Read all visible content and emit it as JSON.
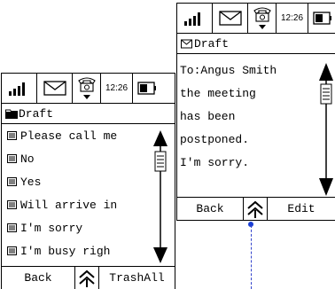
{
  "left_screen": {
    "status": {
      "time": "12:26"
    },
    "title": "Draft",
    "items": [
      {
        "label": "Please call me"
      },
      {
        "label": "No"
      },
      {
        "label": "Yes"
      },
      {
        "label": "Will arrive in"
      },
      {
        "label": "I'm sorry"
      },
      {
        "label": "I'm busy righ"
      }
    ],
    "buttons": {
      "left": "Back",
      "right": "TrashAll"
    }
  },
  "right_screen": {
    "status": {
      "time": "12:26"
    },
    "title": "Draft",
    "lines": [
      {
        "text": "To:Angus Smith"
      },
      {
        "text": "the meeting"
      },
      {
        "text": "has been"
      },
      {
        "text": "postponed."
      },
      {
        "text": "I'm sorry."
      }
    ],
    "buttons": {
      "left": "Back",
      "right": "Edit"
    }
  },
  "icons": {
    "signal": "signal-strength-icon",
    "message": "envelope-icon",
    "phone": "telephone-icon",
    "battery": "battery-icon",
    "folder": "folder-icon",
    "doc": "document-icon",
    "menu": "menu-arrow-icon"
  },
  "colors": {
    "annotation": "#1a3fd4"
  }
}
